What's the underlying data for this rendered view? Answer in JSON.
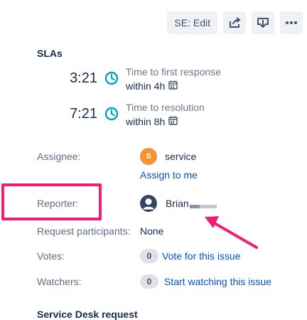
{
  "toolbar": {
    "edit_label": "SE: Edit",
    "share_icon": "share-icon",
    "export_icon": "export-icon",
    "more_icon": "more-icon"
  },
  "slas": {
    "title": "SLAs",
    "items": [
      {
        "time": "3:21",
        "label": "Time to first response",
        "target": "within 4h"
      },
      {
        "time": "7:21",
        "label": "Time to resolution",
        "target": "within 8h"
      }
    ]
  },
  "fields": {
    "assignee": {
      "label": "Assignee:",
      "value": "service",
      "avatar_initial": "S",
      "action": "Assign to me"
    },
    "reporter": {
      "label": "Reporter:",
      "value": "Brian"
    },
    "participants": {
      "label": "Request participants:",
      "value": "None"
    },
    "votes": {
      "label": "Votes:",
      "count": "0",
      "action": "Vote for this issue"
    },
    "watchers": {
      "label": "Watchers:",
      "count": "0",
      "action": "Start watching this issue"
    }
  },
  "service_desk": {
    "title": "Service Desk request"
  },
  "colors": {
    "highlight": "#ef1f72",
    "link": "#0052cc",
    "sla_clock": "#00a3bf",
    "assignee_avatar": "#f79232"
  }
}
